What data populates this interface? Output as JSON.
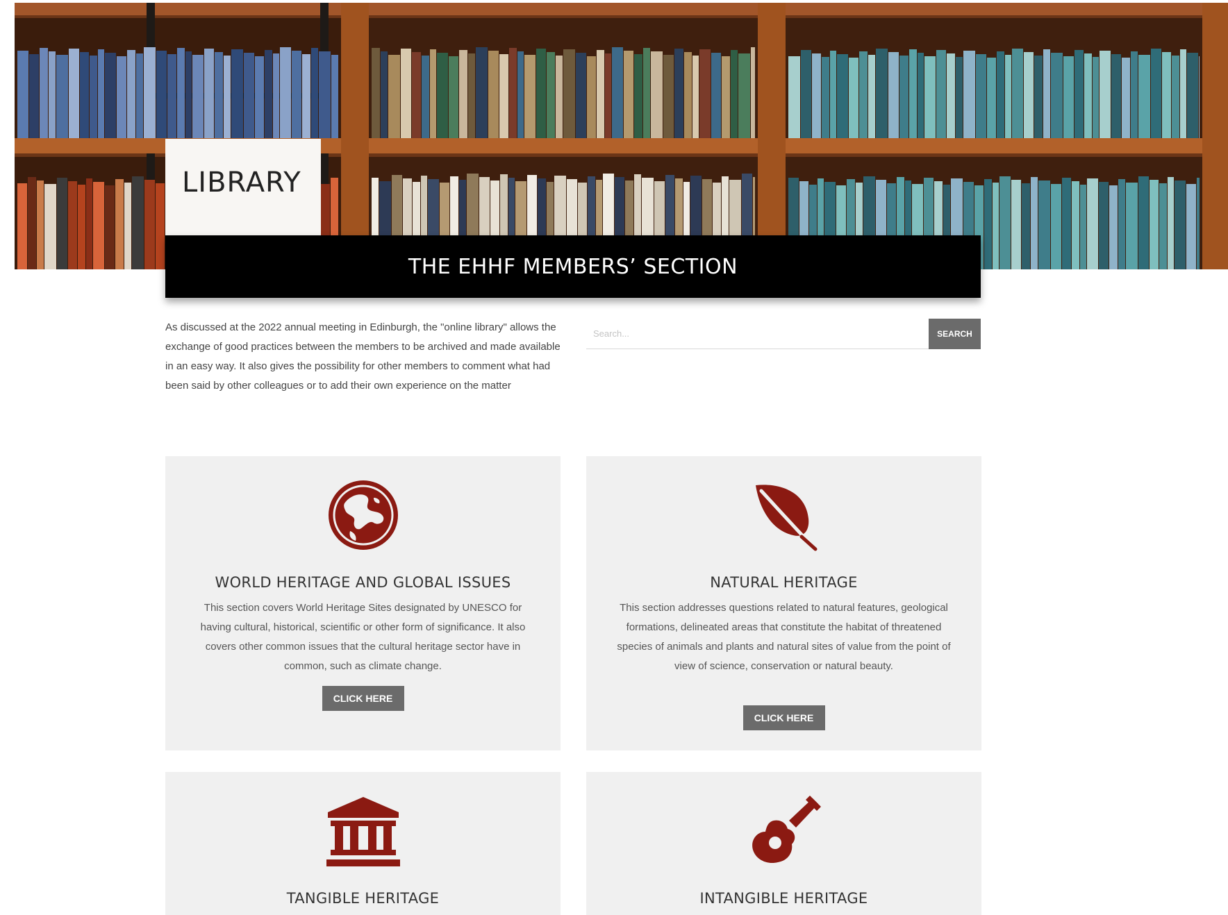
{
  "hero": {
    "library_label": "LIBRARY",
    "banner_title": "THE EHHF MEMBERS’ SECTION"
  },
  "intro": {
    "text": "As discussed at the 2022 annual meeting in Edinburgh, the \"online library\" allows the exchange of good practices between the members to be archived and made available in an easy way. It also gives the possibility for other members to comment what had been said by other colleagues or to add their own experience on the matter"
  },
  "search": {
    "placeholder": "Search...",
    "button_label": "SEARCH"
  },
  "cards": [
    {
      "icon": "globe-icon",
      "title": "WORLD HERITAGE AND GLOBAL ISSUES",
      "description": "This section covers World Heritage Sites  designated by UNESCO for having cultural, historical, scientific or other form of significance. It also covers other common issues that the cultural heritage sector have in common, such as climate change.",
      "button_label": "CLICK HERE"
    },
    {
      "icon": "leaf-icon",
      "title": "NATURAL HERITAGE",
      "description": "This section addresses questions related to  natural features, geological formations, delineated areas that constitute the habitat of threatened species of animals and plants and natural sites of value from the point of view of science, conservation or natural beauty.",
      "button_label": "CLICK HERE"
    },
    {
      "icon": "museum-icon",
      "title": "TANGIBLE HERITAGE"
    },
    {
      "icon": "guitar-icon",
      "title": "INTANGIBLE HERITAGE"
    }
  ],
  "colors": {
    "icon_red": "#8b1a12",
    "button_gray": "#6b6b6b",
    "card_bg": "#f0f0f0",
    "banner_black": "#000000"
  }
}
